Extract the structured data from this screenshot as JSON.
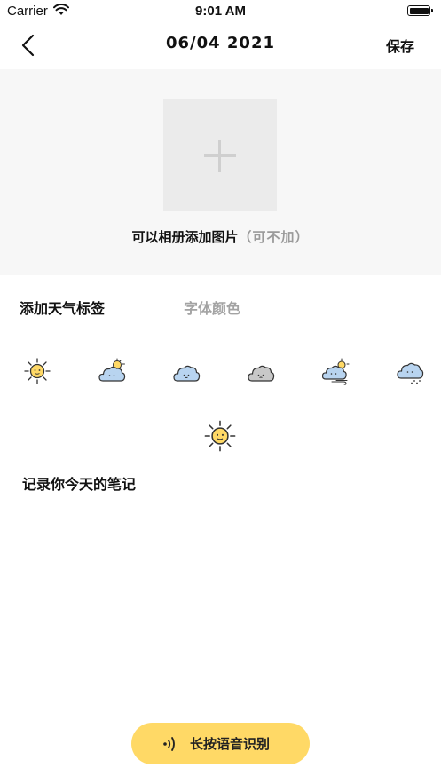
{
  "status_bar": {
    "carrier": "Carrier",
    "time": "9:01 AM",
    "wifi_icon": "wifi-icon",
    "battery_icon": "battery-icon"
  },
  "nav": {
    "back_icon": "chevron-left-icon",
    "title": "06/04  2021",
    "save_label": "保存"
  },
  "photo": {
    "add_icon": "plus-icon",
    "hint": "可以相册添加图片",
    "optional_note": "（可不加）"
  },
  "tabs": [
    {
      "label": "添加天气标签",
      "active": true
    },
    {
      "label": "字体颜色",
      "active": false
    }
  ],
  "weather_options": [
    {
      "icon": "sunny-icon"
    },
    {
      "icon": "partly-cloudy-icon"
    },
    {
      "icon": "cloudy-icon"
    },
    {
      "icon": "overcast-icon"
    },
    {
      "icon": "windy-cloudy-icon"
    },
    {
      "icon": "snow-icon"
    }
  ],
  "selected_weather": {
    "icon": "sunny-icon"
  },
  "note": {
    "heading": "记录你今天的笔记"
  },
  "voice": {
    "icon": "voice-wave-icon",
    "label": "长按语音识别"
  },
  "colors": {
    "accent": "#ffd966",
    "photo_bg": "#f7f7f7",
    "tile_bg": "#ebebeb",
    "inactive_tab": "#a3a3a3",
    "sun": "#ffd966",
    "cloud_blue": "#b8d4f0",
    "cloud_gray": "#c8c8c8"
  }
}
